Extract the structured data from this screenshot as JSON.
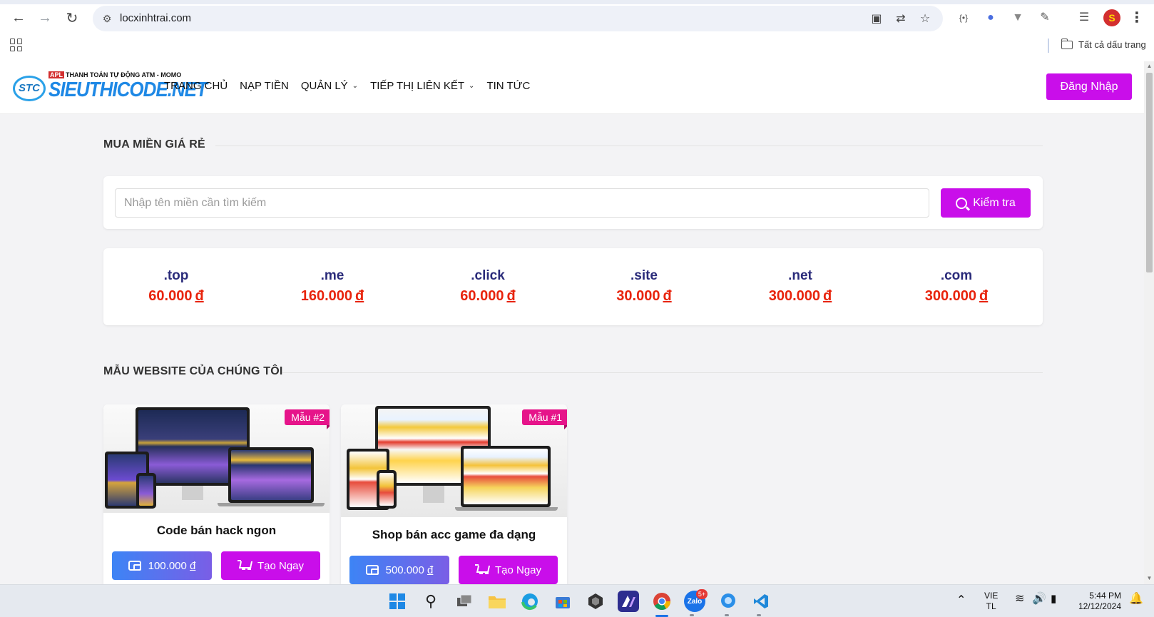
{
  "browser": {
    "url": "locxinhtrai.com",
    "bookmarks_label": "Tất cả dấu trang"
  },
  "site": {
    "logo_tagline_badge": "APL",
    "logo_tagline": "THANH TOÁN TỰ ĐỘNG ATM - MOMO",
    "logo_badge": "STC",
    "logo_text": "SIEUTHICODE.NET",
    "nav": [
      {
        "label": "TRANG CHỦ",
        "dropdown": false
      },
      {
        "label": "NẠP TIỀN",
        "dropdown": false
      },
      {
        "label": "QUẢN LÝ",
        "dropdown": true
      },
      {
        "label": "TIẾP THỊ LIÊN KẾT",
        "dropdown": true
      },
      {
        "label": "TIN TỨC",
        "dropdown": false
      }
    ],
    "login_label": "Đăng Nhập"
  },
  "domain_section": {
    "title": "MUA MIỀN GIÁ RẺ",
    "search_placeholder": "Nhập tên miền cần tìm kiếm",
    "check_label": "Kiểm tra",
    "currency": "đ",
    "tlds": [
      {
        "name": ".top",
        "price": "60.000"
      },
      {
        "name": ".me",
        "price": "160.000"
      },
      {
        "name": ".click",
        "price": "60.000"
      },
      {
        "name": ".site",
        "price": "30.000"
      },
      {
        "name": ".net",
        "price": "300.000"
      },
      {
        "name": ".com",
        "price": "300.000"
      }
    ]
  },
  "templates_section": {
    "title": "MẪU WEBSITE CỦA CHÚNG TÔI",
    "cards": [
      {
        "ribbon": "Mẫu #2",
        "name": "Code bán hack ngon",
        "price": "100.000",
        "create_label": "Tạo Ngay"
      },
      {
        "ribbon": "Mẫu #1",
        "name": "Shop bán acc game đa dạng",
        "price": "500.000",
        "create_label": "Tạo Ngay"
      }
    ]
  },
  "taskbar": {
    "zalo_badge": "5+",
    "zalo_label": "Zalo",
    "language_line1": "VIE",
    "language_line2": "TL",
    "time": "5:44 PM",
    "date": "12/12/2024"
  },
  "colors": {
    "accent": "#c90eea",
    "price_red": "#e8240d",
    "tld_navy": "#2a2b7a",
    "ribbon_pink": "#e6148a"
  }
}
